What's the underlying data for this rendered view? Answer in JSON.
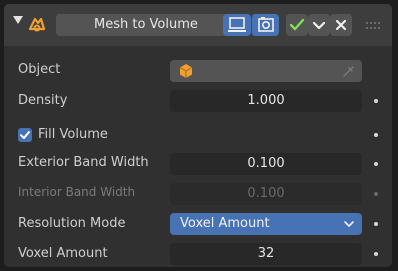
{
  "modifier": {
    "name": "Mesh to Volume",
    "icons": {
      "expand": "expand-arrow-icon",
      "modifier": "mesh-to-volume-icon",
      "edit_mode": "edit-mode-icon",
      "render": "render-icon",
      "apply": "checkmark-icon",
      "dropdown": "chevron-down-icon",
      "close": "close-icon",
      "drag": "drag-handle-icon"
    }
  },
  "fields": {
    "object_label": "Object",
    "density_label": "Density",
    "density_value": "1.000",
    "fill_volume_label": "Fill Volume",
    "fill_volume_checked": true,
    "exterior_label": "Exterior Band Width",
    "exterior_value": "0.100",
    "interior_label": "Interior Band Width",
    "interior_value": "0.100",
    "resolution_mode_label": "Resolution Mode",
    "resolution_mode_value": "Voxel Amount",
    "voxel_amount_label": "Voxel Amount",
    "voxel_amount_value": "32"
  },
  "colors": {
    "accent": "#4772b3",
    "object_icon": "#f0a030",
    "modifier_icon": "#f0a030",
    "apply_icon": "#7ee04e"
  }
}
